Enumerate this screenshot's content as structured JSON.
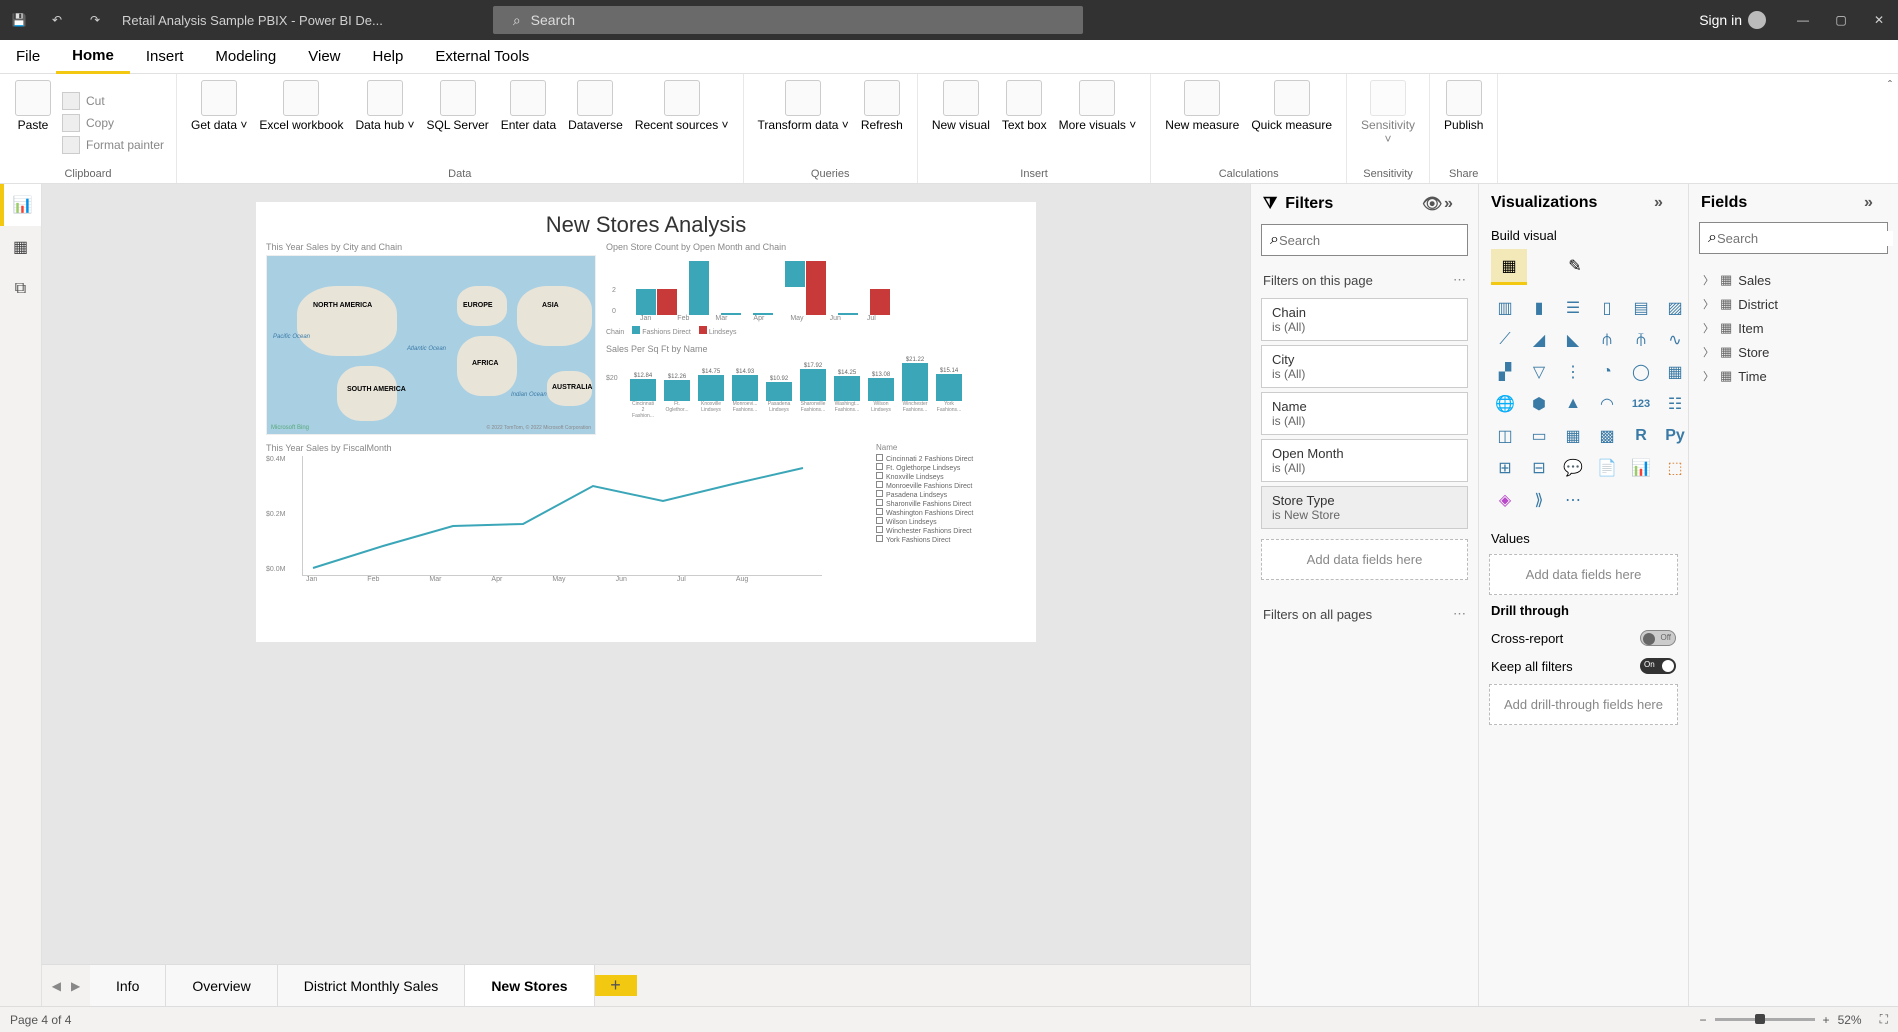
{
  "title": "Retail Analysis Sample PBIX - Power BI De...",
  "search_placeholder": "Search",
  "signin": "Sign in",
  "menu": {
    "file": "File",
    "home": "Home",
    "insert": "Insert",
    "modeling": "Modeling",
    "view": "View",
    "help": "Help",
    "external": "External Tools"
  },
  "ribbon": {
    "paste": "Paste",
    "cut": "Cut",
    "copy": "Copy",
    "format_painter": "Format painter",
    "get_data": "Get data",
    "excel": "Excel workbook",
    "data_hub": "Data hub",
    "sql": "SQL Server",
    "enter": "Enter data",
    "dataverse": "Dataverse",
    "recent": "Recent sources",
    "transform": "Transform data",
    "refresh": "Refresh",
    "new_visual": "New visual",
    "text_box": "Text box",
    "more_visuals": "More visuals",
    "new_measure": "New measure",
    "quick_measure": "Quick measure",
    "sensitivity": "Sensitivity",
    "publish": "Publish",
    "g_clipboard": "Clipboard",
    "g_data": "Data",
    "g_queries": "Queries",
    "g_insert": "Insert",
    "g_calc": "Calculations",
    "g_sens": "Sensitivity",
    "g_share": "Share"
  },
  "report": {
    "title": "New Stores Analysis",
    "vis1_title": "This Year Sales by City and Chain",
    "vis2_title": "Open Store Count by Open Month and Chain",
    "vis3_title": "Sales Per Sq Ft by Name",
    "vis4_title": "This Year Sales by FiscalMonth",
    "legend_chain": "Chain",
    "legend_fd": "Fashions Direct",
    "legend_li": "Lindseys",
    "map": {
      "na": "NORTH AMERICA",
      "sa": "SOUTH AMERICA",
      "eu": "EUROPE",
      "af": "AFRICA",
      "as": "ASIA",
      "au": "AUSTRALIA",
      "pac": "Pacific Ocean",
      "atl": "Atlantic Ocean",
      "ind": "Indian Ocean",
      "bing": "Microsoft Bing",
      "copy": "© 2022 TomTom, © 2022 Microsoft Corporation"
    },
    "legend_name": "Name",
    "names": [
      "Cincinnati 2 Fashions Direct",
      "Ft. Oglethorpe Lindseys",
      "Knoxville Lindseys",
      "Monroeville Fashions Direct",
      "Pasadena Lindseys",
      "Sharonville Fashions Direct",
      "Washington Fashions Direct",
      "Wilson Lindseys",
      "Winchester Fashions Direct",
      "York Fashions Direct"
    ]
  },
  "chart_data": [
    {
      "type": "bar",
      "title": "Open Store Count by Open Month and Chain",
      "categories": [
        "Jan",
        "Feb",
        "Mar",
        "Apr",
        "May",
        "Jun",
        "Jul"
      ],
      "series": [
        {
          "name": "Fashions Direct",
          "values": [
            1,
            2,
            0,
            0,
            1,
            0,
            0
          ]
        },
        {
          "name": "Lindseys",
          "values": [
            1,
            0,
            0,
            0,
            2,
            0,
            1
          ]
        }
      ],
      "ylim": [
        0,
        2
      ],
      "xlabel": "",
      "ylabel": ""
    },
    {
      "type": "bar",
      "title": "Sales Per Sq Ft by Name",
      "categories": [
        "Cincinnati 2 Fashion...",
        "Ft. Oglethor...",
        "Knoxville Lindseys",
        "Monroevi... Fashions...",
        "Pasadena Lindseys",
        "Sharonville Fashions...",
        "Washingt... Fashions...",
        "Wilson Lindseys",
        "Winchester Fashions...",
        "York Fashions..."
      ],
      "values": [
        12.84,
        12.26,
        14.75,
        14.93,
        10.92,
        17.92,
        14.25,
        13.08,
        21.22,
        15.14
      ],
      "ylim": [
        0,
        22
      ],
      "ylabel": "$",
      "xlabel": ""
    },
    {
      "type": "line",
      "title": "This Year Sales by FiscalMonth",
      "x": [
        "Jan",
        "Feb",
        "Mar",
        "Apr",
        "May",
        "Jun",
        "Jul",
        "Aug"
      ],
      "values": [
        0.04,
        0.11,
        0.17,
        0.18,
        0.33,
        0.28,
        0.34,
        0.4
      ],
      "ylim": [
        0,
        0.4
      ],
      "ylabel": "$M",
      "ytick": [
        "$0.0M",
        "$0.2M",
        "$0.4M"
      ]
    }
  ],
  "pages": {
    "info": "Info",
    "overview": "Overview",
    "district": "District Monthly Sales",
    "new_stores": "New Stores"
  },
  "filters": {
    "title": "Filters",
    "search": "Search",
    "on_page": "Filters on this page",
    "cards": [
      {
        "name": "Chain",
        "val": "is (All)"
      },
      {
        "name": "City",
        "val": "is (All)"
      },
      {
        "name": "Name",
        "val": "is (All)"
      },
      {
        "name": "Open Month",
        "val": "is (All)"
      },
      {
        "name": "Store Type",
        "val": "is New Store"
      }
    ],
    "add": "Add data fields here",
    "on_all": "Filters on all pages"
  },
  "viz": {
    "title": "Visualizations",
    "build": "Build visual",
    "values": "Values",
    "add_values": "Add data fields here",
    "drill": "Drill through",
    "cross": "Cross-report",
    "off": "Off",
    "keep": "Keep all filters",
    "on": "On",
    "add_drill": "Add drill-through fields here"
  },
  "fields": {
    "title": "Fields",
    "search": "Search",
    "tables": [
      "Sales",
      "District",
      "Item",
      "Store",
      "Time"
    ]
  },
  "status": {
    "page": "Page 4 of 4",
    "zoom": "52%"
  }
}
